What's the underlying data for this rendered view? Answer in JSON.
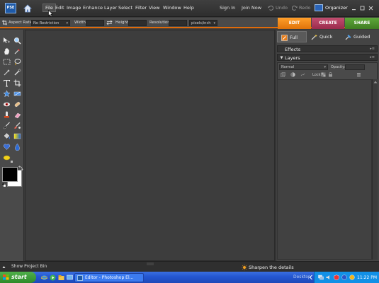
{
  "app": {
    "logo_text": "PSE"
  },
  "menu": {
    "items": [
      "File",
      "Edit",
      "Image",
      "Enhance",
      "Layer",
      "Select",
      "Filter",
      "View",
      "Window",
      "Help"
    ]
  },
  "top_links": {
    "sign_in": "Sign In",
    "join_now": "Join Now",
    "undo": "Undo",
    "redo": "Redo",
    "organizer": "Organizer"
  },
  "options": {
    "aspect_ratio_label": "Aspect Ratio:",
    "aspect_ratio_value": "No Restriction",
    "width_label": "Width:",
    "height_label": "Height:",
    "resolution_label": "Resolution:",
    "resolution_unit": "pixels/inch"
  },
  "workspace_tabs": {
    "edit": "EDIT",
    "create": "CREATE",
    "share": "SHARE"
  },
  "edit_modes": {
    "full": "Full",
    "quick": "Quick",
    "guided": "Guided",
    "active": "Full"
  },
  "panels": {
    "effects": "Effects",
    "layers": "Layers",
    "blend_mode": "Normal",
    "opacity_label": "Opacity:",
    "lock_label": "Lock:"
  },
  "bottom": {
    "project_bin": "Show Project Bin",
    "hint": "Sharpen the details"
  },
  "taskbar": {
    "start": "start",
    "task": "Editor - Photoshop El...",
    "desktop": "Desktop",
    "clock": "11:22 PM"
  },
  "colors": {
    "edit_tab": "#f08a1a",
    "create_tab": "#b03d5f",
    "share_tab": "#4f9a30",
    "accent_line": "#e06b0a"
  },
  "tools": [
    "move-tool-icon",
    "zoom-tool-icon",
    "hand-tool-icon",
    "eyedropper-tool-icon",
    "marquee-tool-icon",
    "lasso-tool-icon",
    "magic-wand-tool-icon",
    "quick-selection-tool-icon",
    "type-tool-icon",
    "crop-tool-icon",
    "cookie-cutter-tool-icon",
    "straighten-tool-icon",
    "red-eye-tool-icon",
    "spot-healing-tool-icon",
    "clone-stamp-tool-icon",
    "eraser-tool-icon",
    "brush-tool-icon",
    "smart-brush-tool-icon",
    "paint-bucket-tool-icon",
    "gradient-tool-icon",
    "shape-tool-icon",
    "blur-tool-icon",
    "sponge-tool-icon"
  ]
}
